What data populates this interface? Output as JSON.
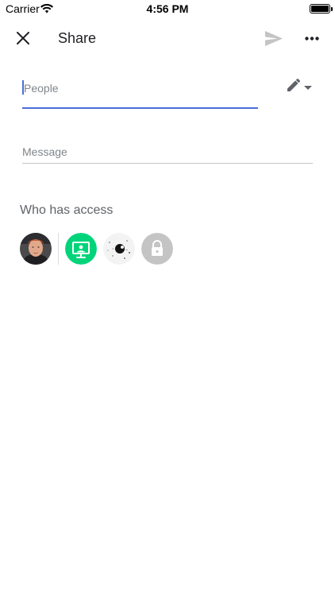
{
  "status_bar": {
    "carrier": "Carrier",
    "time": "4:56 PM",
    "battery_level": 1.0
  },
  "header": {
    "title": "Share",
    "close_icon": "close-icon",
    "send_icon": "send-icon",
    "more_icon": "more-horizontal-icon"
  },
  "people_field": {
    "placeholder": "People",
    "value": "",
    "role_icon": "pencil-icon"
  },
  "message_field": {
    "placeholder": "Message",
    "value": ""
  },
  "access": {
    "title": "Who has access",
    "members": [
      {
        "kind": "user-photo"
      },
      {
        "kind": "classroom",
        "icon": "classroom-icon",
        "color": "#00d47a"
      },
      {
        "kind": "user-photo-abstract"
      },
      {
        "kind": "restricted",
        "icon": "lock-icon",
        "color": "#c4c4c4"
      }
    ]
  },
  "colors": {
    "accent": "#4a6fd8",
    "disabled_icon": "#c4c4c4",
    "muted_text": "#5f6368"
  }
}
